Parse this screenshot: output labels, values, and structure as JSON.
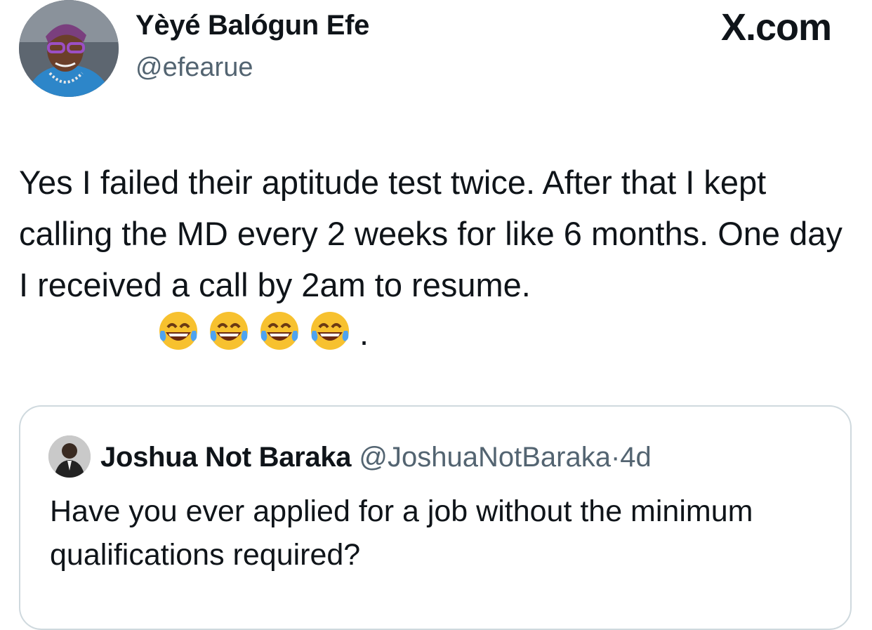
{
  "tweet": {
    "author": {
      "name": "Yèyé Balógun Efe",
      "handle": "@efearue"
    },
    "brand": "X.com",
    "text": "Yes I failed their aptitude test twice. After that I kept calling the MD every 2 weeks for like 6 months. One day I received a call by 2am to resume.",
    "emoji": [
      "face-with-tears-of-joy",
      "face-with-tears-of-joy",
      "face-with-tears-of-joy",
      "face-with-tears-of-joy"
    ],
    "trailing": "."
  },
  "quote": {
    "author": {
      "name": "Joshua Not Baraka",
      "handle": "@JoshuaNotBaraka",
      "separator": "·",
      "time": "4d"
    },
    "text": "Have you ever applied for a job without the minimum qualifications required?"
  }
}
